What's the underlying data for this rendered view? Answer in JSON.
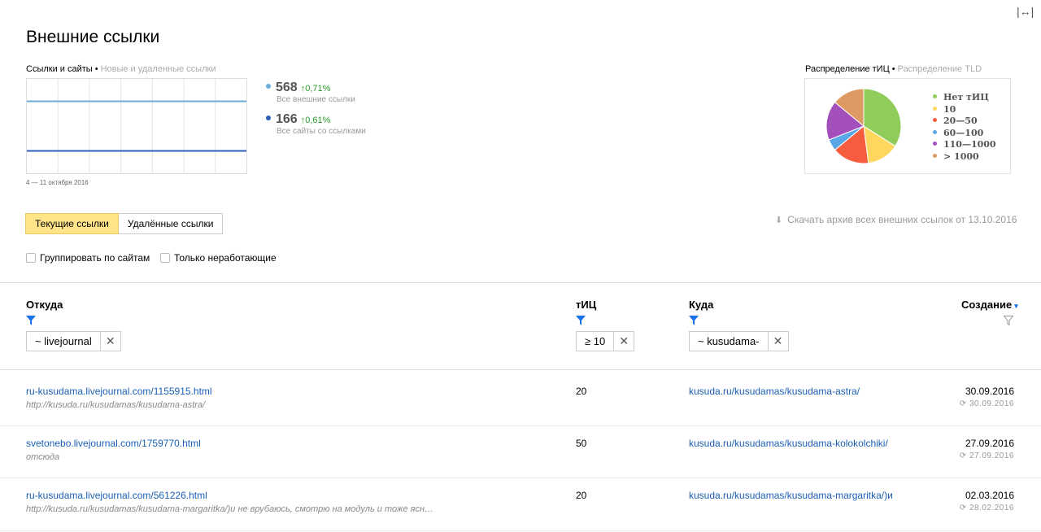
{
  "header": {
    "expand_icon": "↔",
    "title": "Внешние ссылки"
  },
  "chart_section": {
    "tab_active": "Ссылки и сайты",
    "tab_separator": "•",
    "tab_inactive": "Новые и удаленные ссылки",
    "date_range": "4 — 11 октября 2016",
    "stats": [
      {
        "value": "568",
        "delta": "↑0,71%",
        "desc": "Все внешние ссылки",
        "color": "#6baed6"
      },
      {
        "value": "166",
        "delta": "↑0,61%",
        "desc": "Все сайты со ссылками",
        "color": "#2c5fb8"
      }
    ]
  },
  "pie_section": {
    "tab_active": "Распределение тИЦ",
    "tab_separator": "•",
    "tab_inactive": "Распределение TLD",
    "legend": [
      {
        "label": "Нет тИЦ",
        "color": "#8fcc5a"
      },
      {
        "label": "10",
        "color": "#ffd75e"
      },
      {
        "label": "20—50",
        "color": "#f65d3e"
      },
      {
        "label": "60—100",
        "color": "#5aa7e6"
      },
      {
        "label": "110—1000",
        "color": "#a34fbc"
      },
      {
        "label": "> 1000",
        "color": "#dd9a63"
      }
    ]
  },
  "chart_data": {
    "type": "pie",
    "title": "Распределение тИЦ",
    "slices": [
      {
        "label": "Нет тИЦ",
        "value": 34,
        "color": "#8fcc5a"
      },
      {
        "label": "10",
        "value": 14,
        "color": "#ffd75e"
      },
      {
        "label": "20—50",
        "value": 16,
        "color": "#f65d3e"
      },
      {
        "label": "60—100",
        "value": 5,
        "color": "#5aa7e6"
      },
      {
        "label": "110—1000",
        "value": 17,
        "color": "#a34fbc"
      },
      {
        "label": "> 1000",
        "value": 14,
        "color": "#dd9a63"
      }
    ]
  },
  "controls": {
    "tab_current": "Текущие ссылки",
    "tab_deleted": "Удалённые ссылки",
    "download_icon": "download-icon",
    "download_label": "Скачать архив всех внешних ссылок от 13.10.2016",
    "group_by_sites": "Группировать по сайтам",
    "only_broken": "Только неработающие"
  },
  "table": {
    "headers": {
      "from": "Откуда",
      "tic": "тИЦ",
      "to": "Куда",
      "created": "Создание",
      "sort_icon": "▾"
    },
    "filters": {
      "from": "~ livejournal",
      "tic": "≥ 10",
      "to": "~ kusudama-",
      "clear": "✕"
    },
    "rows": [
      {
        "from_url": "ru-kusudama.livejournal.com/1155915.html",
        "from_sub": "http://kusuda.ru/kusudamas/kusudama-astra/",
        "tic": "20",
        "to_url": "kusuda.ru/kusudamas/kusudama-astra/",
        "created": "30.09.2016",
        "checked": "30.09.2016"
      },
      {
        "from_url": "svetonebo.livejournal.com/1759770.html",
        "from_sub": "отсюда",
        "tic": "50",
        "to_url": "kusuda.ru/kusudamas/kusudama-kolokolchiki/",
        "created": "27.09.2016",
        "checked": "27.09.2016"
      },
      {
        "from_url": "ru-kusudama.livejournal.com/561226.html",
        "from_sub": "http://kusuda.ru/kusudamas/kusudama-margaritka/)и не врубаюсь, смотрю на модуль и тоже ясн…",
        "tic": "20",
        "to_url": "kusuda.ru/kusudamas/kusudama-margaritka/)и",
        "created": "02.03.2016",
        "checked": "28.02.2016"
      }
    ],
    "refresh_icon": "⟳"
  }
}
